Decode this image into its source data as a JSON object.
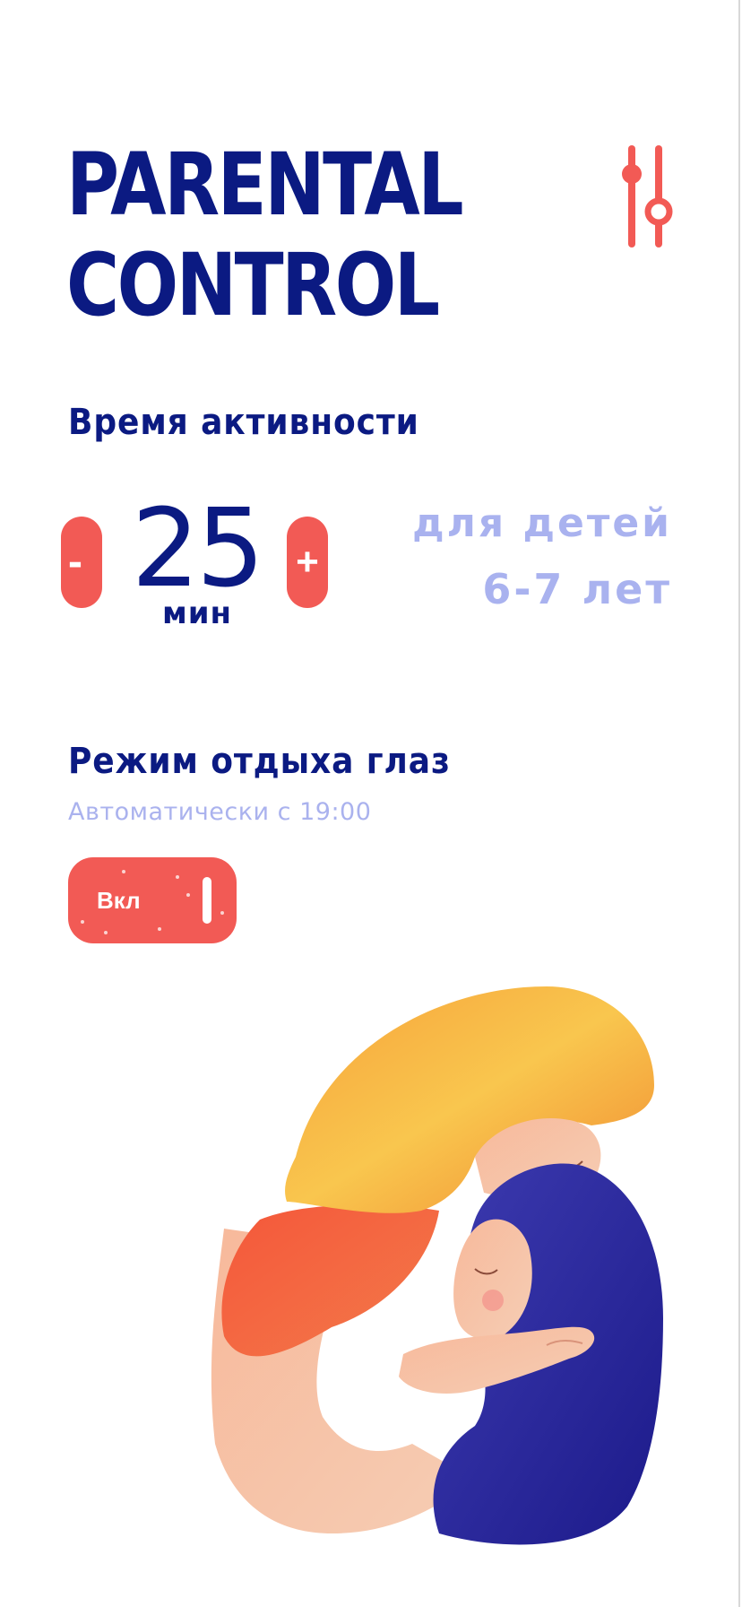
{
  "header": {
    "title_line1": "PARENTAL",
    "title_line2": "CONTROL",
    "settings_icon": "sliders-icon"
  },
  "activity": {
    "heading": "Время активности",
    "minus_label": "-",
    "plus_label": "+",
    "value": "25",
    "unit": "мин",
    "age_line1": "для детей",
    "age_line2": "6-7 лет"
  },
  "eye_rest": {
    "heading": "Режим отдыха глаз",
    "subtitle": "Автоматически с 19:00",
    "toggle_label": "Вкл",
    "toggle_on": true
  },
  "illustration": {
    "icon": "mother-hugging-child-illustration"
  },
  "colors": {
    "primary": "#0b1a82",
    "accent": "#f25a55",
    "muted": "#a9b2ef",
    "background": "#ffffff"
  }
}
